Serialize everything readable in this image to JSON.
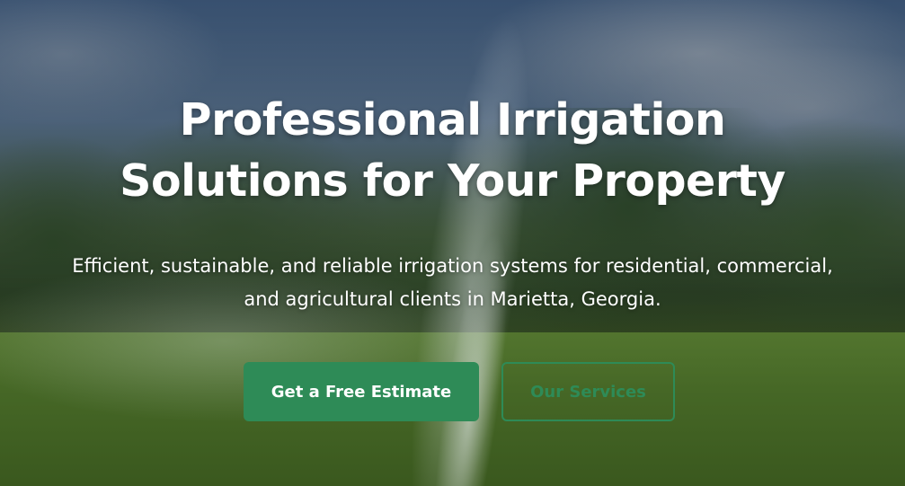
{
  "hero": {
    "headline_line1": "Professional Irrigation",
    "headline_line2": "Solutions for Your Property",
    "subtext_line1": "Efficient, sustainable, and reliable irrigation systems for residential, commercial,",
    "subtext_line2": "and agricultural clients in Marietta, Georgia.",
    "primary_button_label": "Get a Free Estimate",
    "secondary_button_label": "Our Services"
  },
  "colors": {
    "accent": "#2e8b57",
    "text": "#ffffff"
  }
}
